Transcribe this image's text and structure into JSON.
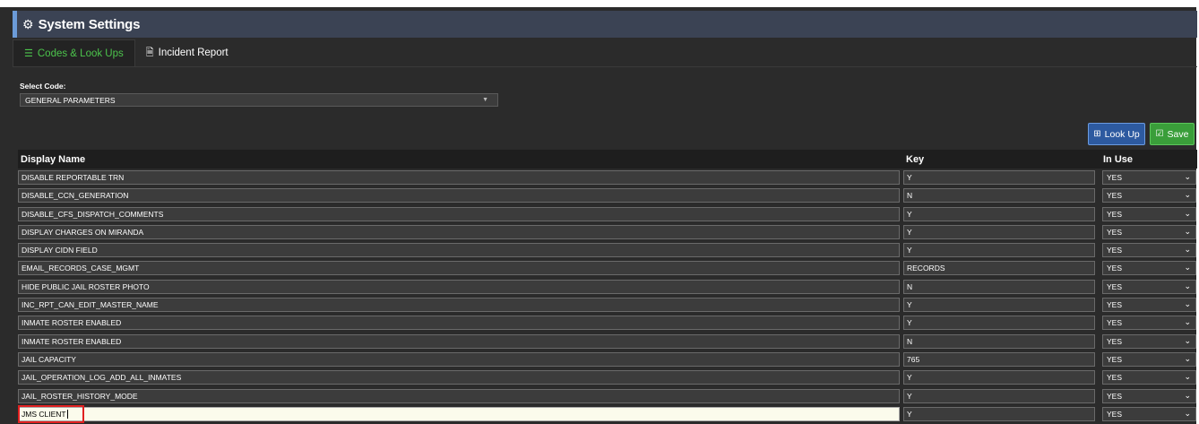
{
  "window": {
    "title": "System Settings"
  },
  "tabs": [
    {
      "label": "Codes & Look Ups",
      "active": true,
      "icon": "list-icon"
    },
    {
      "label": "Incident Report",
      "active": false,
      "icon": "file-icon"
    }
  ],
  "select_code": {
    "label": "Select Code:",
    "value": "GENERAL PARAMETERS"
  },
  "toolbar": {
    "lookup_label": "Look Up",
    "save_label": "Save"
  },
  "table": {
    "headers": {
      "name": "Display Name",
      "key": "Key",
      "in_use": "In Use"
    },
    "rows": [
      {
        "name": "DISABLE REPORTABLE TRN",
        "key": "Y",
        "in_use": "YES"
      },
      {
        "name": "DISABLE_CCN_GENERATION",
        "key": "N",
        "in_use": "YES"
      },
      {
        "name": "DISABLE_CFS_DISPATCH_COMMENTS",
        "key": "Y",
        "in_use": "YES"
      },
      {
        "name": "DISPLAY CHARGES ON MIRANDA",
        "key": "Y",
        "in_use": "YES"
      },
      {
        "name": "DISPLAY CIDN FIELD",
        "key": "Y",
        "in_use": "YES"
      },
      {
        "name": "EMAIL_RECORDS_CASE_MGMT",
        "key": "RECORDS",
        "in_use": "YES"
      },
      {
        "name": "HIDE PUBLIC JAIL ROSTER PHOTO",
        "key": "N",
        "in_use": "YES"
      },
      {
        "name": "INC_RPT_CAN_EDIT_MASTER_NAME",
        "key": "Y",
        "in_use": "YES"
      },
      {
        "name": "INMATE ROSTER ENABLED",
        "key": "Y",
        "in_use": "YES"
      },
      {
        "name": "INMATE ROSTER ENABLED",
        "key": "N",
        "in_use": "YES"
      },
      {
        "name": "JAIL CAPACITY",
        "key": "765",
        "in_use": "YES"
      },
      {
        "name": "JAIL_OPERATION_LOG_ADD_ALL_INMATES",
        "key": "Y",
        "in_use": "YES"
      },
      {
        "name": "JAIL_ROSTER_HISTORY_MODE",
        "key": "Y",
        "in_use": "YES"
      },
      {
        "name": "JMS CLIENT",
        "key": "Y",
        "in_use": "YES",
        "editing": true
      }
    ]
  },
  "colors": {
    "accent_green": "#4cc44c",
    "lookup_blue": "#2d5aa0",
    "save_green": "#3a9e3a",
    "focus_red": "#e02020"
  }
}
